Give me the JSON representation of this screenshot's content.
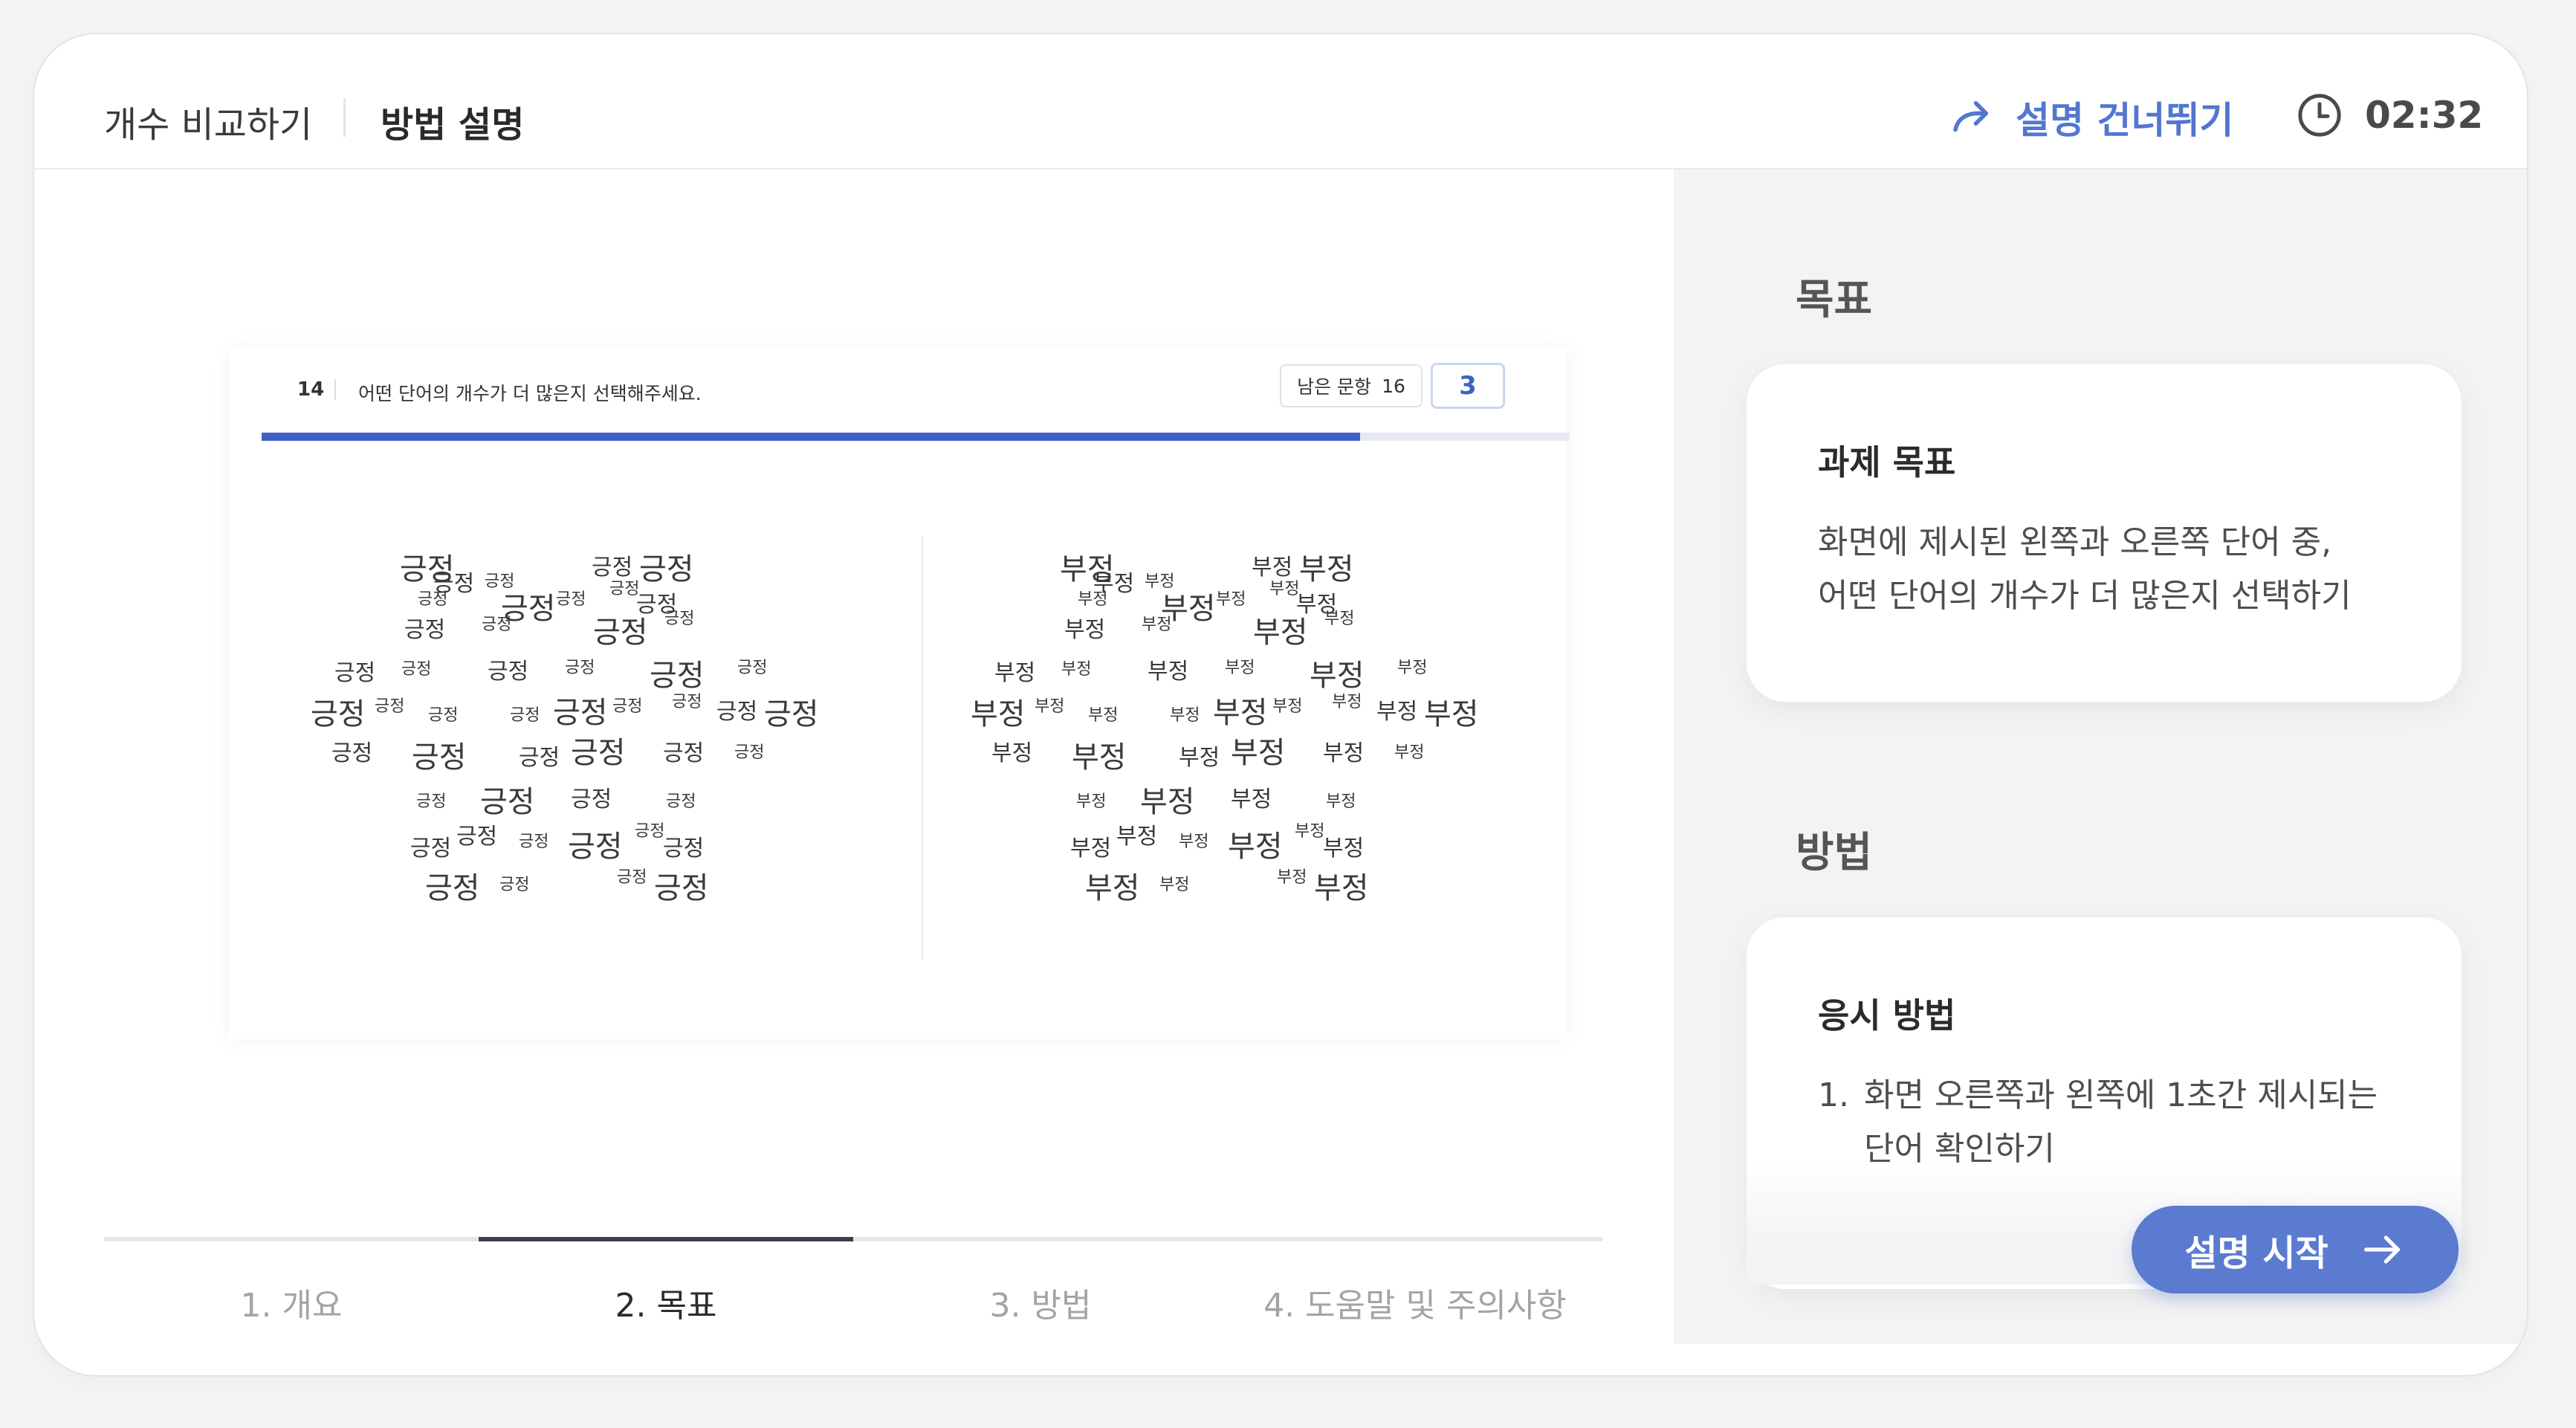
{
  "header": {
    "breadcrumb_1": "개수 비교하기",
    "breadcrumb_2": "방법 설명",
    "skip_label": "설명 건너뛰기",
    "timer": "02:32"
  },
  "preview": {
    "question_number": "14",
    "question_text": "어떤 단어의 개수가 더  많은지 선택해주세요.",
    "remaining_label": "남은 문항",
    "remaining_count": "16",
    "answer_value": "3",
    "progress": 0.84,
    "left_word": "긍정",
    "right_word": "부정"
  },
  "tabs": [
    {
      "label": "1. 개요",
      "active": false
    },
    {
      "label": "2. 목표",
      "active": true
    },
    {
      "label": "3. 방법",
      "active": false
    },
    {
      "label": "4. 도움말 및 주의사항",
      "active": false
    }
  ],
  "sidebar": {
    "goal_section_title": "목표",
    "goal_card_title": "과제 목표",
    "goal_card_text_1": "화면에 제시된 왼쪽과 오른쪽 단어 중,",
    "goal_card_text_2": "어떤 단어의 개수가 더 많은지 선택하기",
    "method_section_title": "방법",
    "method_card_title": "응시 방법",
    "method_step_number": "1.",
    "method_step_text_1": "화면 오른쪽과 왼쪽에 1초간 제시되는",
    "method_step_text_2": "단어 확인하기"
  },
  "start_button": {
    "label": "설명 시작"
  },
  "colors": {
    "accent": "#5b7bd1",
    "progress": "#3f62c6",
    "sidebar_bg": "#f3f3f4"
  }
}
